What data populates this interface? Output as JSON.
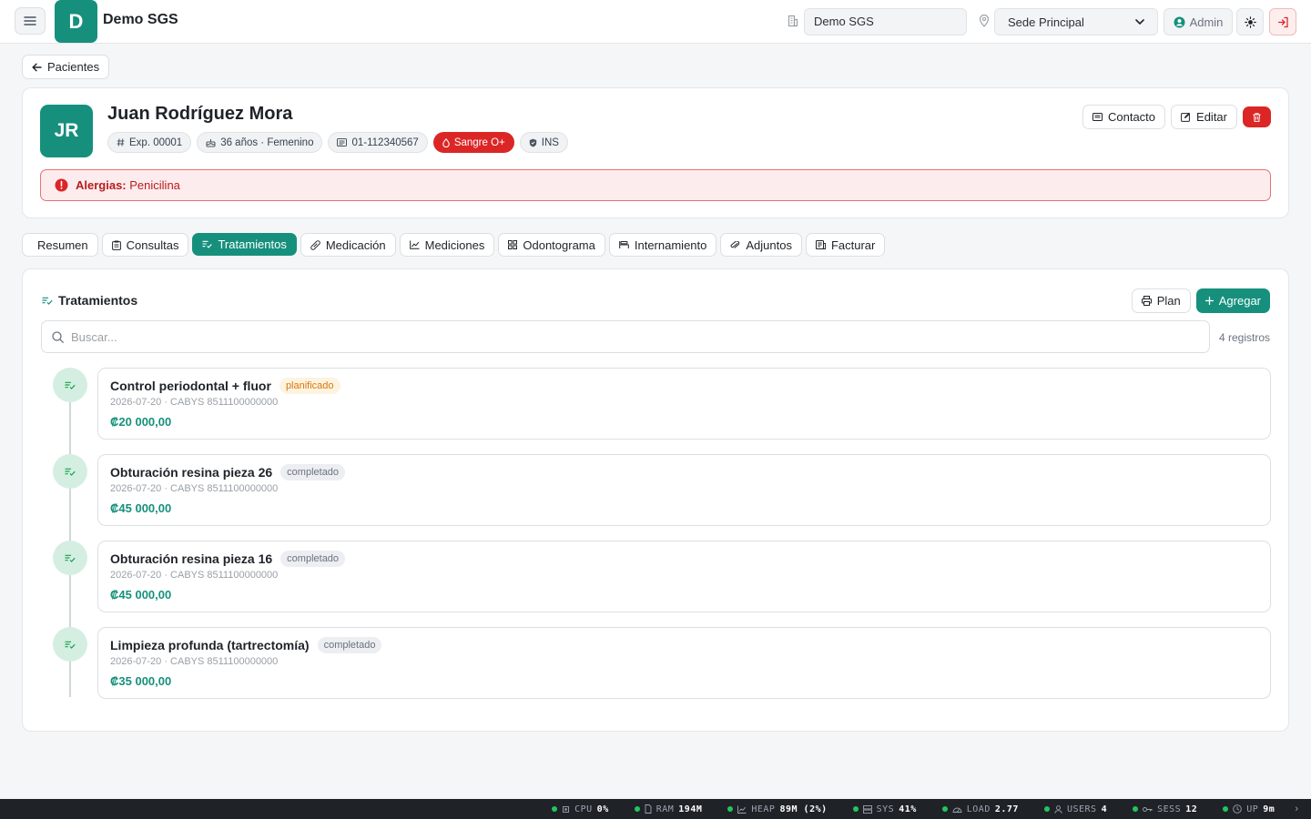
{
  "topbar": {
    "logo_letter": "D",
    "app_title": "Demo SGS",
    "org_value": "Demo SGS",
    "sede_value": "Sede Principal",
    "admin_label": "Admin"
  },
  "back_label": "Pacientes",
  "patient": {
    "initials": "JR",
    "name": "Juan Rodríguez Mora",
    "chips": {
      "exp": "Exp. 00001",
      "age_gender": "36 años · Femenino",
      "id": "01-112340567",
      "blood": "Sangre O+",
      "insurance": "INS"
    },
    "actions": {
      "contact": "Contacto",
      "edit": "Editar"
    },
    "allergy_label": "Alergias:",
    "allergy_value": "Penicilina"
  },
  "tabs": [
    "Resumen",
    "Consultas",
    "Tratamientos",
    "Medicación",
    "Mediciones",
    "Odontograma",
    "Internamiento",
    "Adjuntos",
    "Facturar"
  ],
  "panel": {
    "title": "Tratamientos",
    "plan_label": "Plan",
    "add_label": "Agregar",
    "search_placeholder": "Buscar...",
    "count": "4 registros"
  },
  "treatments": [
    {
      "name": "Control periodontal + fluor",
      "status": "planificado",
      "meta": "2026-07-20 · CABYS 8511100000000",
      "price": "₡20 000,00"
    },
    {
      "name": "Obturación resina pieza 26",
      "status": "completado",
      "meta": "2026-07-20 · CABYS 8511100000000",
      "price": "₡45 000,00"
    },
    {
      "name": "Obturación resina pieza 16",
      "status": "completado",
      "meta": "2026-07-20 · CABYS 8511100000000",
      "price": "₡45 000,00"
    },
    {
      "name": "Limpieza profunda (tartrectomía)",
      "status": "completado",
      "meta": "2026-07-20 · CABYS 8511100000000",
      "price": "₡35 000,00"
    }
  ],
  "status_bar": [
    {
      "label": "CPU",
      "value": "0%"
    },
    {
      "label": "RAM",
      "value": "194M"
    },
    {
      "label": "HEAP",
      "value": "89M (2%)"
    },
    {
      "label": "SYS",
      "value": "41%"
    },
    {
      "label": "LOAD",
      "value": "2.77"
    },
    {
      "label": "USERS",
      "value": "4"
    },
    {
      "label": "SESS",
      "value": "12"
    },
    {
      "label": "UP",
      "value": "9m"
    }
  ],
  "colors": {
    "primary": "#16907d",
    "danger": "#dc2626",
    "planned": "#d97706"
  }
}
